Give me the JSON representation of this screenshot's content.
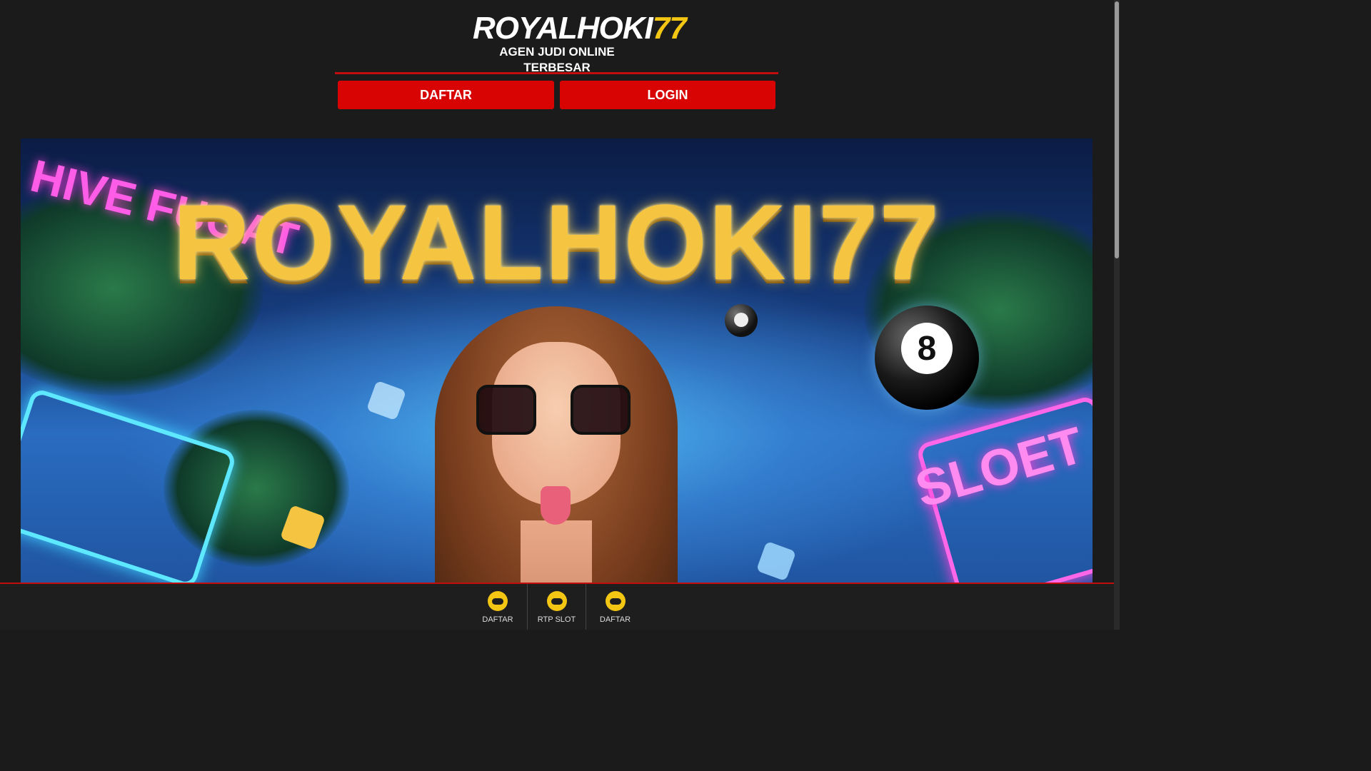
{
  "header": {
    "logo_main_white": "ROYALHOKI",
    "logo_main_accent": "77",
    "logo_sub": "AGEN JUDI ONLINE TERBESAR",
    "daftar_label": "DAFTAR",
    "login_label": "LOGIN"
  },
  "banner": {
    "title": "ROYALHOKI77",
    "neon_left_text": "HIVE FUGAT",
    "neon_right_text": "SLOET",
    "ball_number": "8"
  },
  "bottom_nav": {
    "items": [
      {
        "label": "DAFTAR",
        "icon": "gamepad-icon"
      },
      {
        "label": "RTP SLOT",
        "icon": "gamepad-icon"
      },
      {
        "label": "DAFTAR",
        "icon": "gamepad-icon"
      }
    ]
  },
  "colors": {
    "background": "#1b1b1b",
    "accent_red": "#d80404",
    "accent_gold": "#f2c612"
  }
}
